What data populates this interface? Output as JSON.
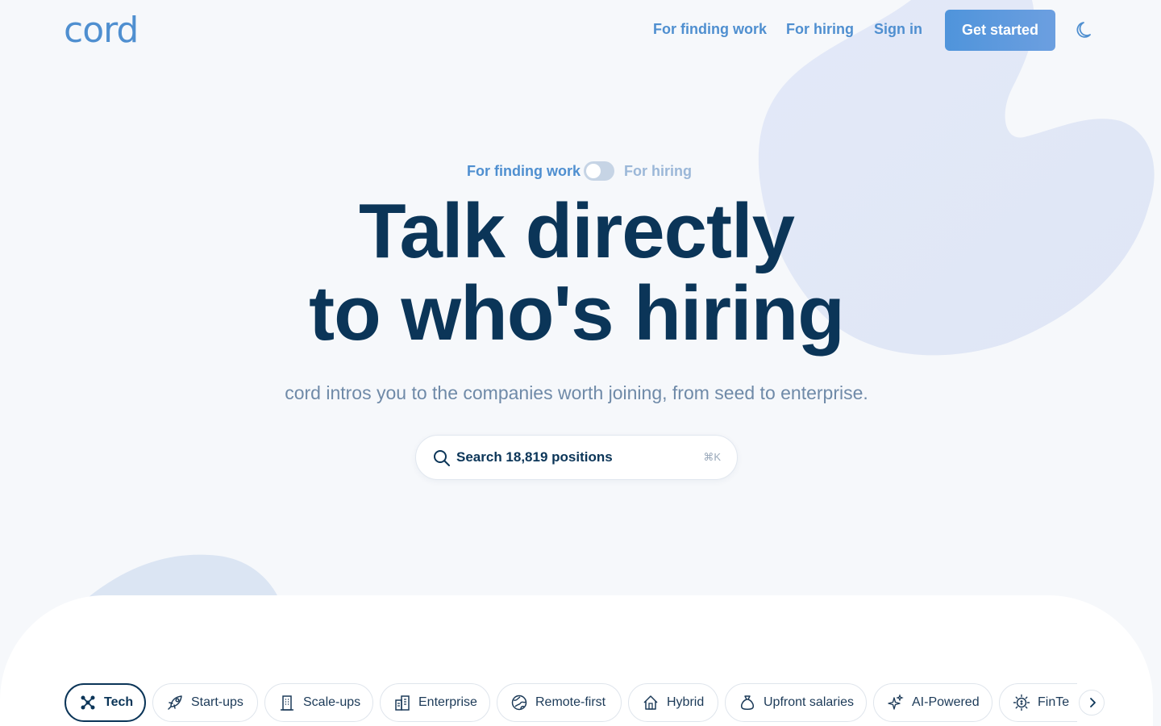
{
  "brand": {
    "logo": "cord"
  },
  "nav": {
    "finding_work": "For finding work",
    "hiring": "For hiring",
    "sign_in": "Sign in",
    "get_started": "Get started",
    "theme_icon": "moon-icon"
  },
  "toggle": {
    "left_label": "For finding work",
    "right_label": "For hiring"
  },
  "hero": {
    "headline_line1": "Talk directly",
    "headline_line2": "to who's hiring",
    "subline": "cord intros you to the companies worth joining, from seed to enterprise."
  },
  "search": {
    "label": "Search 18,819 positions",
    "shortcut": "⌘K",
    "icon": "search-icon"
  },
  "categories": [
    {
      "label": "Tech",
      "icon": "network-icon",
      "active": true
    },
    {
      "label": "Start-ups",
      "icon": "rocket-icon"
    },
    {
      "label": "Scale-ups",
      "icon": "building-icon"
    },
    {
      "label": "Enterprise",
      "icon": "office-icon"
    },
    {
      "label": "Remote-first",
      "icon": "globe-icon"
    },
    {
      "label": "Hybrid",
      "icon": "house-icon"
    },
    {
      "label": "Upfront salaries",
      "icon": "money-bag-icon"
    },
    {
      "label": "AI-Powered",
      "icon": "sparkle-icon"
    },
    {
      "label": "FinTe",
      "icon": "coin-icon"
    }
  ],
  "colors": {
    "brand_blue": "#4f8fd0",
    "navy": "#0b3558",
    "blob": "#e0e8f7"
  }
}
